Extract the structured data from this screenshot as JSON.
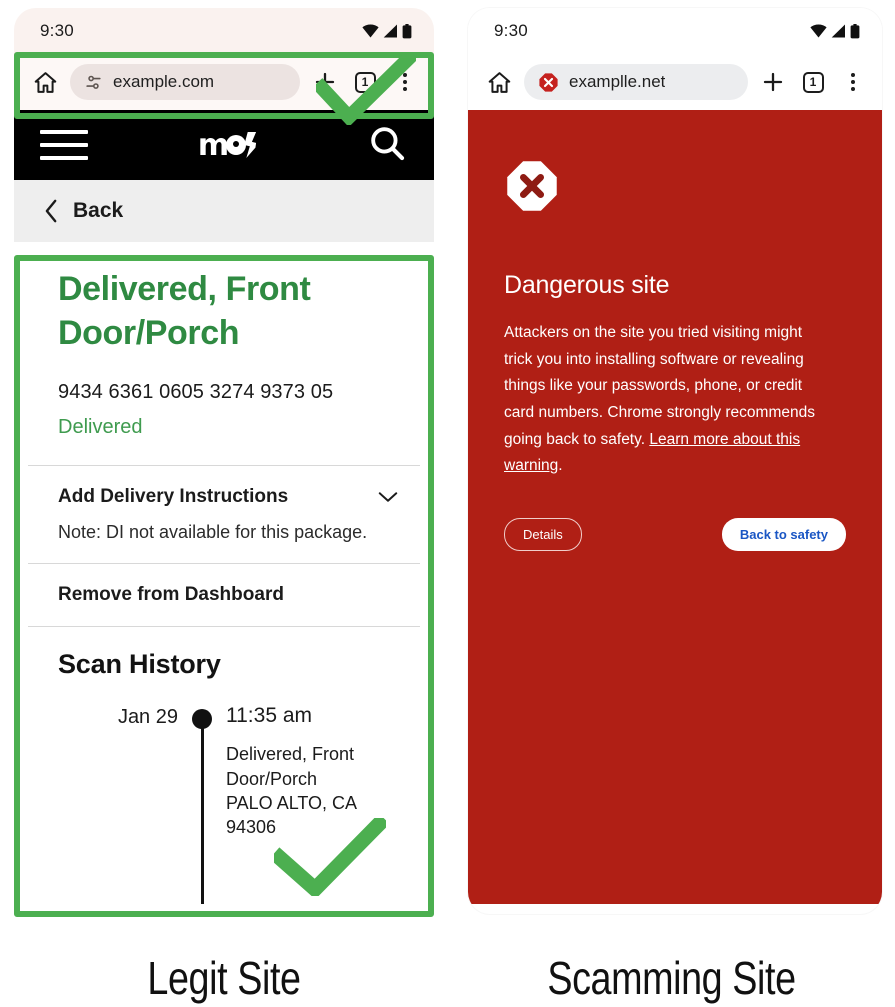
{
  "left_phone": {
    "status_bar": {
      "time": "9:30",
      "icons": [
        "wifi-icon",
        "signal-icon",
        "battery-icon"
      ]
    },
    "browser_toolbar": {
      "home_icon": "home-icon",
      "url": "example.com",
      "url_security_icon": "tune-settings-icon",
      "new_tab_label": "+",
      "tab_count": "1",
      "menu_icon": "kebab-menu-icon"
    },
    "site_header": {
      "menu_icon": "hamburger-icon",
      "logo_alt": "mg",
      "search_icon": "search-icon"
    },
    "back_row": {
      "label": "Back",
      "icon": "chevron-left-icon"
    },
    "delivery_card": {
      "title": "Delivered, Front Door/Porch",
      "tracking_number": "9434 6361 0605 3274 9373 05",
      "status": "Delivered"
    },
    "instructions_row": {
      "label": "Add Delivery Instructions",
      "chevron": "chevron-down-icon",
      "note": "Note: DI not available for this package."
    },
    "remove_row": {
      "label": "Remove from Dashboard"
    },
    "scan_history": {
      "title": "Scan History",
      "entries": [
        {
          "date": "Jan 29",
          "time": "11:35 am",
          "description": "Delivered, Front Door/Porch",
          "location": "PALO ALTO, CA 94306"
        }
      ]
    },
    "annotation": {
      "check_icon": "green-check-icon",
      "highlight_color": "#4caf50"
    }
  },
  "right_phone": {
    "status_bar": {
      "time": "9:30",
      "icons": [
        "wifi-icon",
        "signal-icon",
        "battery-icon"
      ]
    },
    "browser_toolbar": {
      "home_icon": "home-icon",
      "url": "examplle.net",
      "url_security_icon": "danger-octagon-icon",
      "new_tab_label": "+",
      "tab_count": "1",
      "menu_icon": "kebab-menu-icon"
    },
    "warning": {
      "icon": "stop-octagon-x-icon",
      "title": "Dangerous site",
      "body_text": "Attackers on the site you tried visiting might trick you into installing software or revealing things like your passwords, phone, or credit card numbers. Chrome strongly recommends going back to safety. ",
      "link_text": "Learn more about this warning",
      "body_tail": ".",
      "details_button": "Details",
      "safety_button": "Back to safety",
      "background_color": "#b01f15"
    }
  },
  "captions": {
    "left": "Legit Site",
    "right": "Scamming Site"
  }
}
